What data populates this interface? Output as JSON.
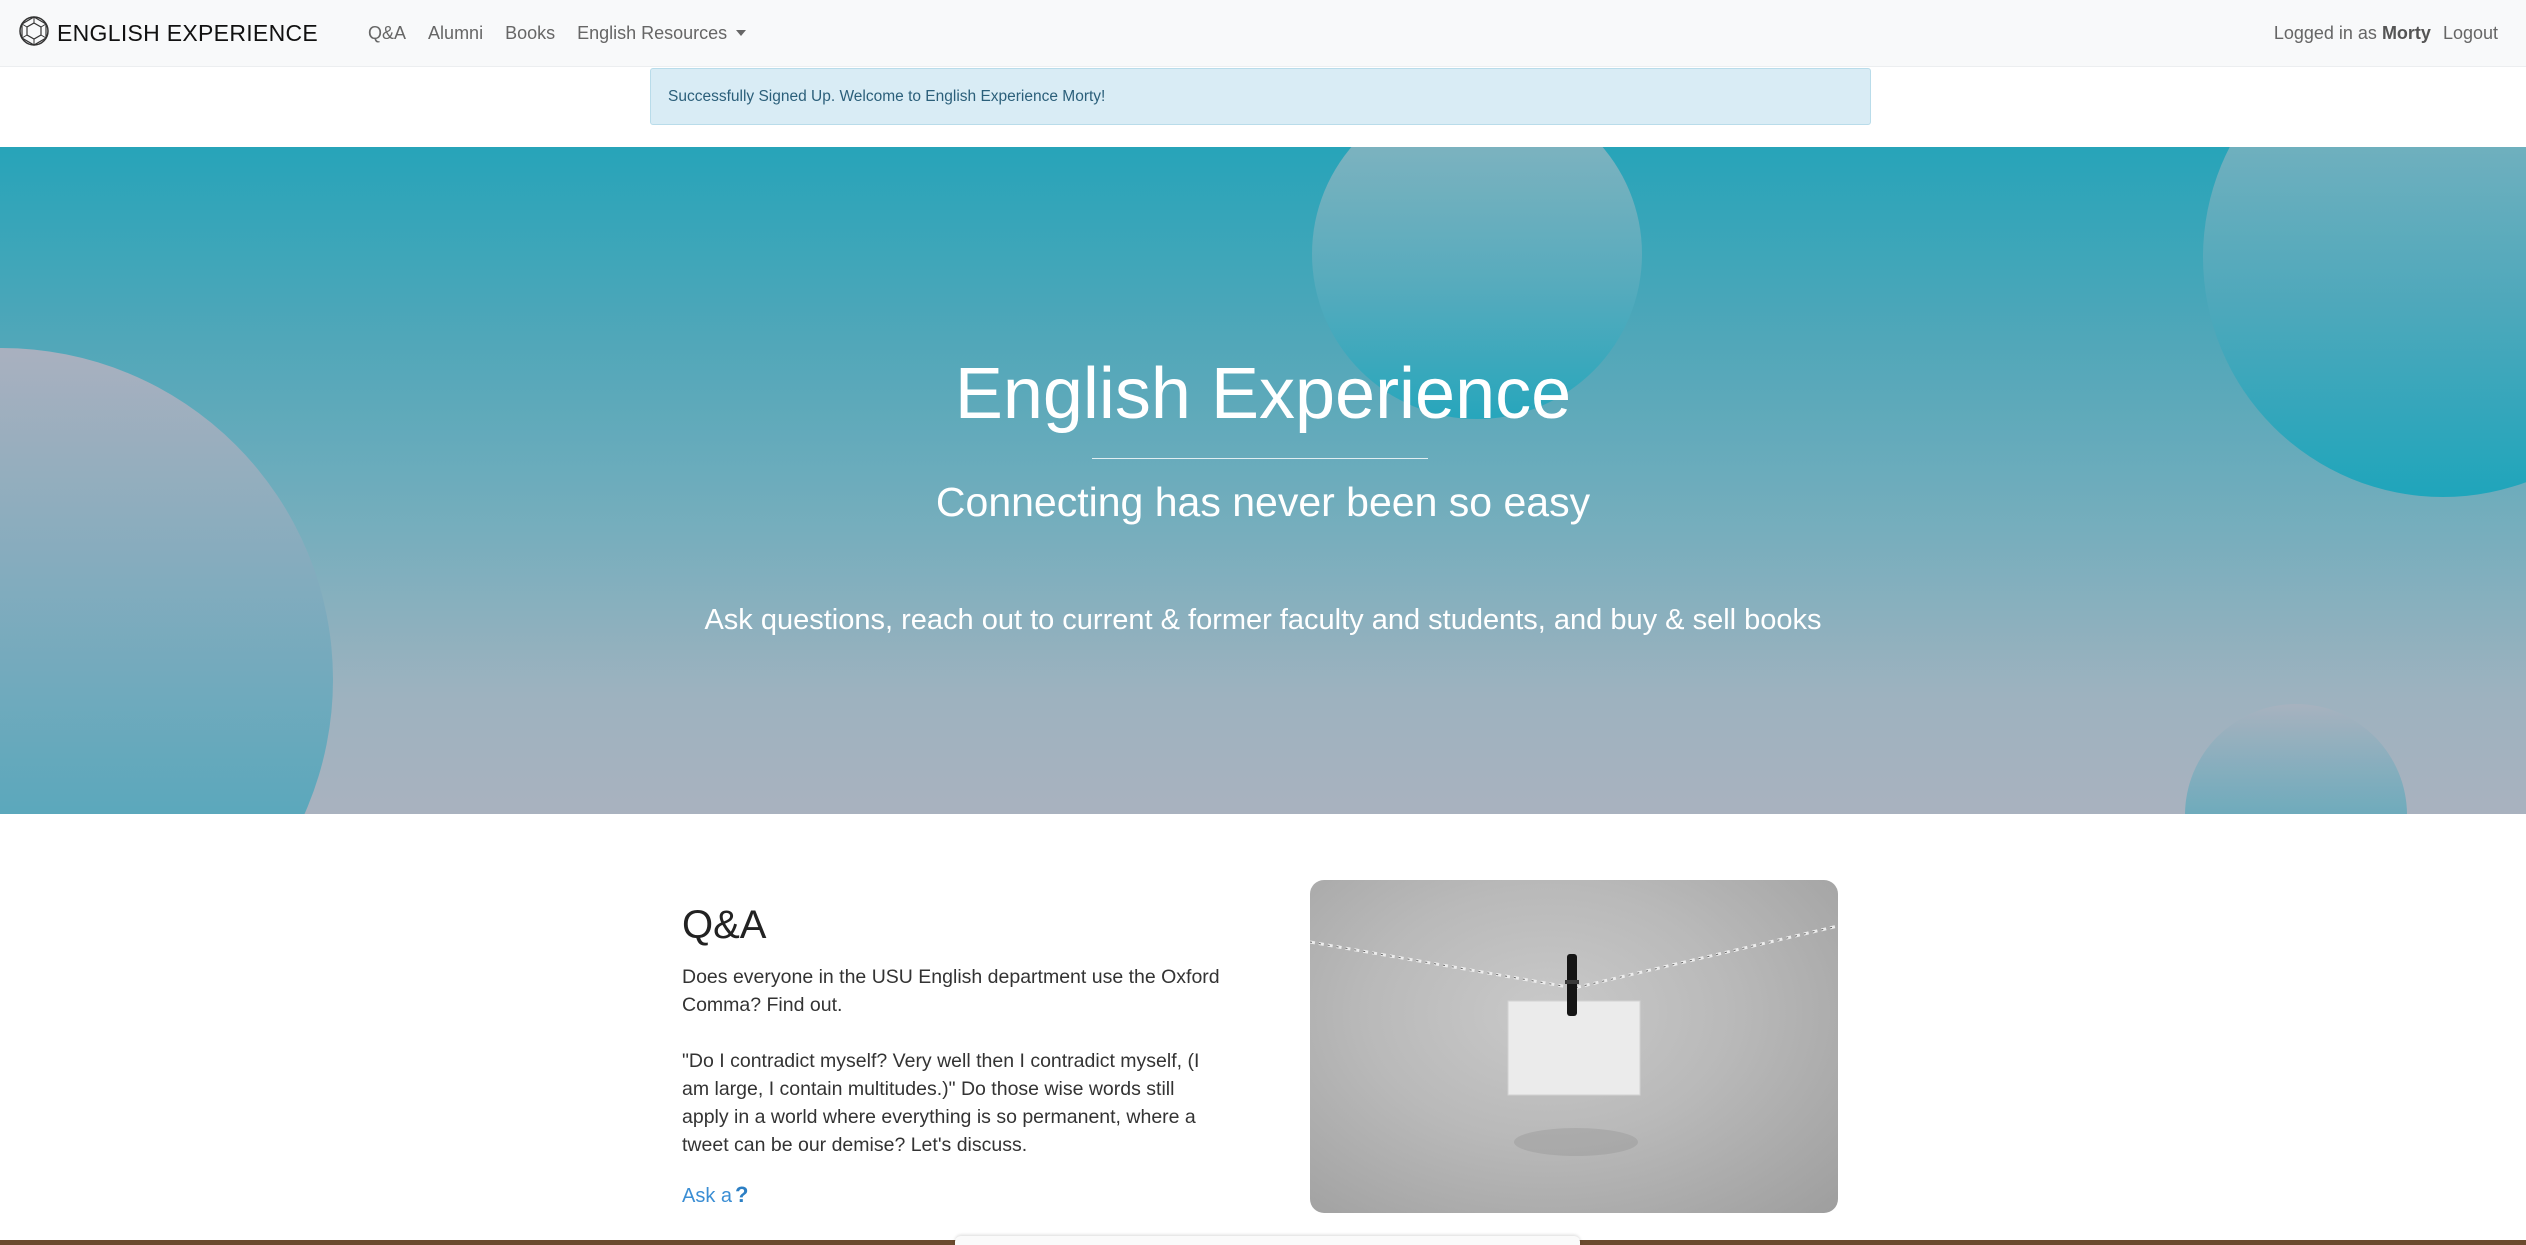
{
  "navbar": {
    "brand": "ENGLISH EXPERIENCE",
    "brand_icon": "geodesic-logo-icon",
    "links": [
      {
        "label": "Q&A"
      },
      {
        "label": "Alumni"
      },
      {
        "label": "Books"
      },
      {
        "label": "English Resources"
      }
    ],
    "logged_in_prefix": "Logged in as",
    "username": "Morty",
    "logout_label": "Logout"
  },
  "alert": {
    "message": "Successfully Signed Up. Welcome to English Experience Morty!"
  },
  "hero": {
    "title": "English Experience",
    "subtitle": "Connecting has never been so easy",
    "description": "Ask questions, reach out to current & former faculty and students, and buy & sell books"
  },
  "qa_section": {
    "title": "Q&A",
    "paragraph1": "Does everyone in the USU English department use the Oxford Comma? Find out.",
    "paragraph2": "\"Do I contradict myself? Very well then I contradict myself, (I am large, I contain multitudes.)\" Do those wise words still apply in a world where everything is so permanent, where a tweet can be our demise? Let's discuss.",
    "ask_link": "Ask a",
    "ask_icon": "question-mark-icon"
  },
  "colors": {
    "hero_top": "#27a4b9",
    "hero_bottom": "#a9b2bf",
    "link": "#3b8ed4",
    "alert_bg": "#d9ecf5"
  }
}
